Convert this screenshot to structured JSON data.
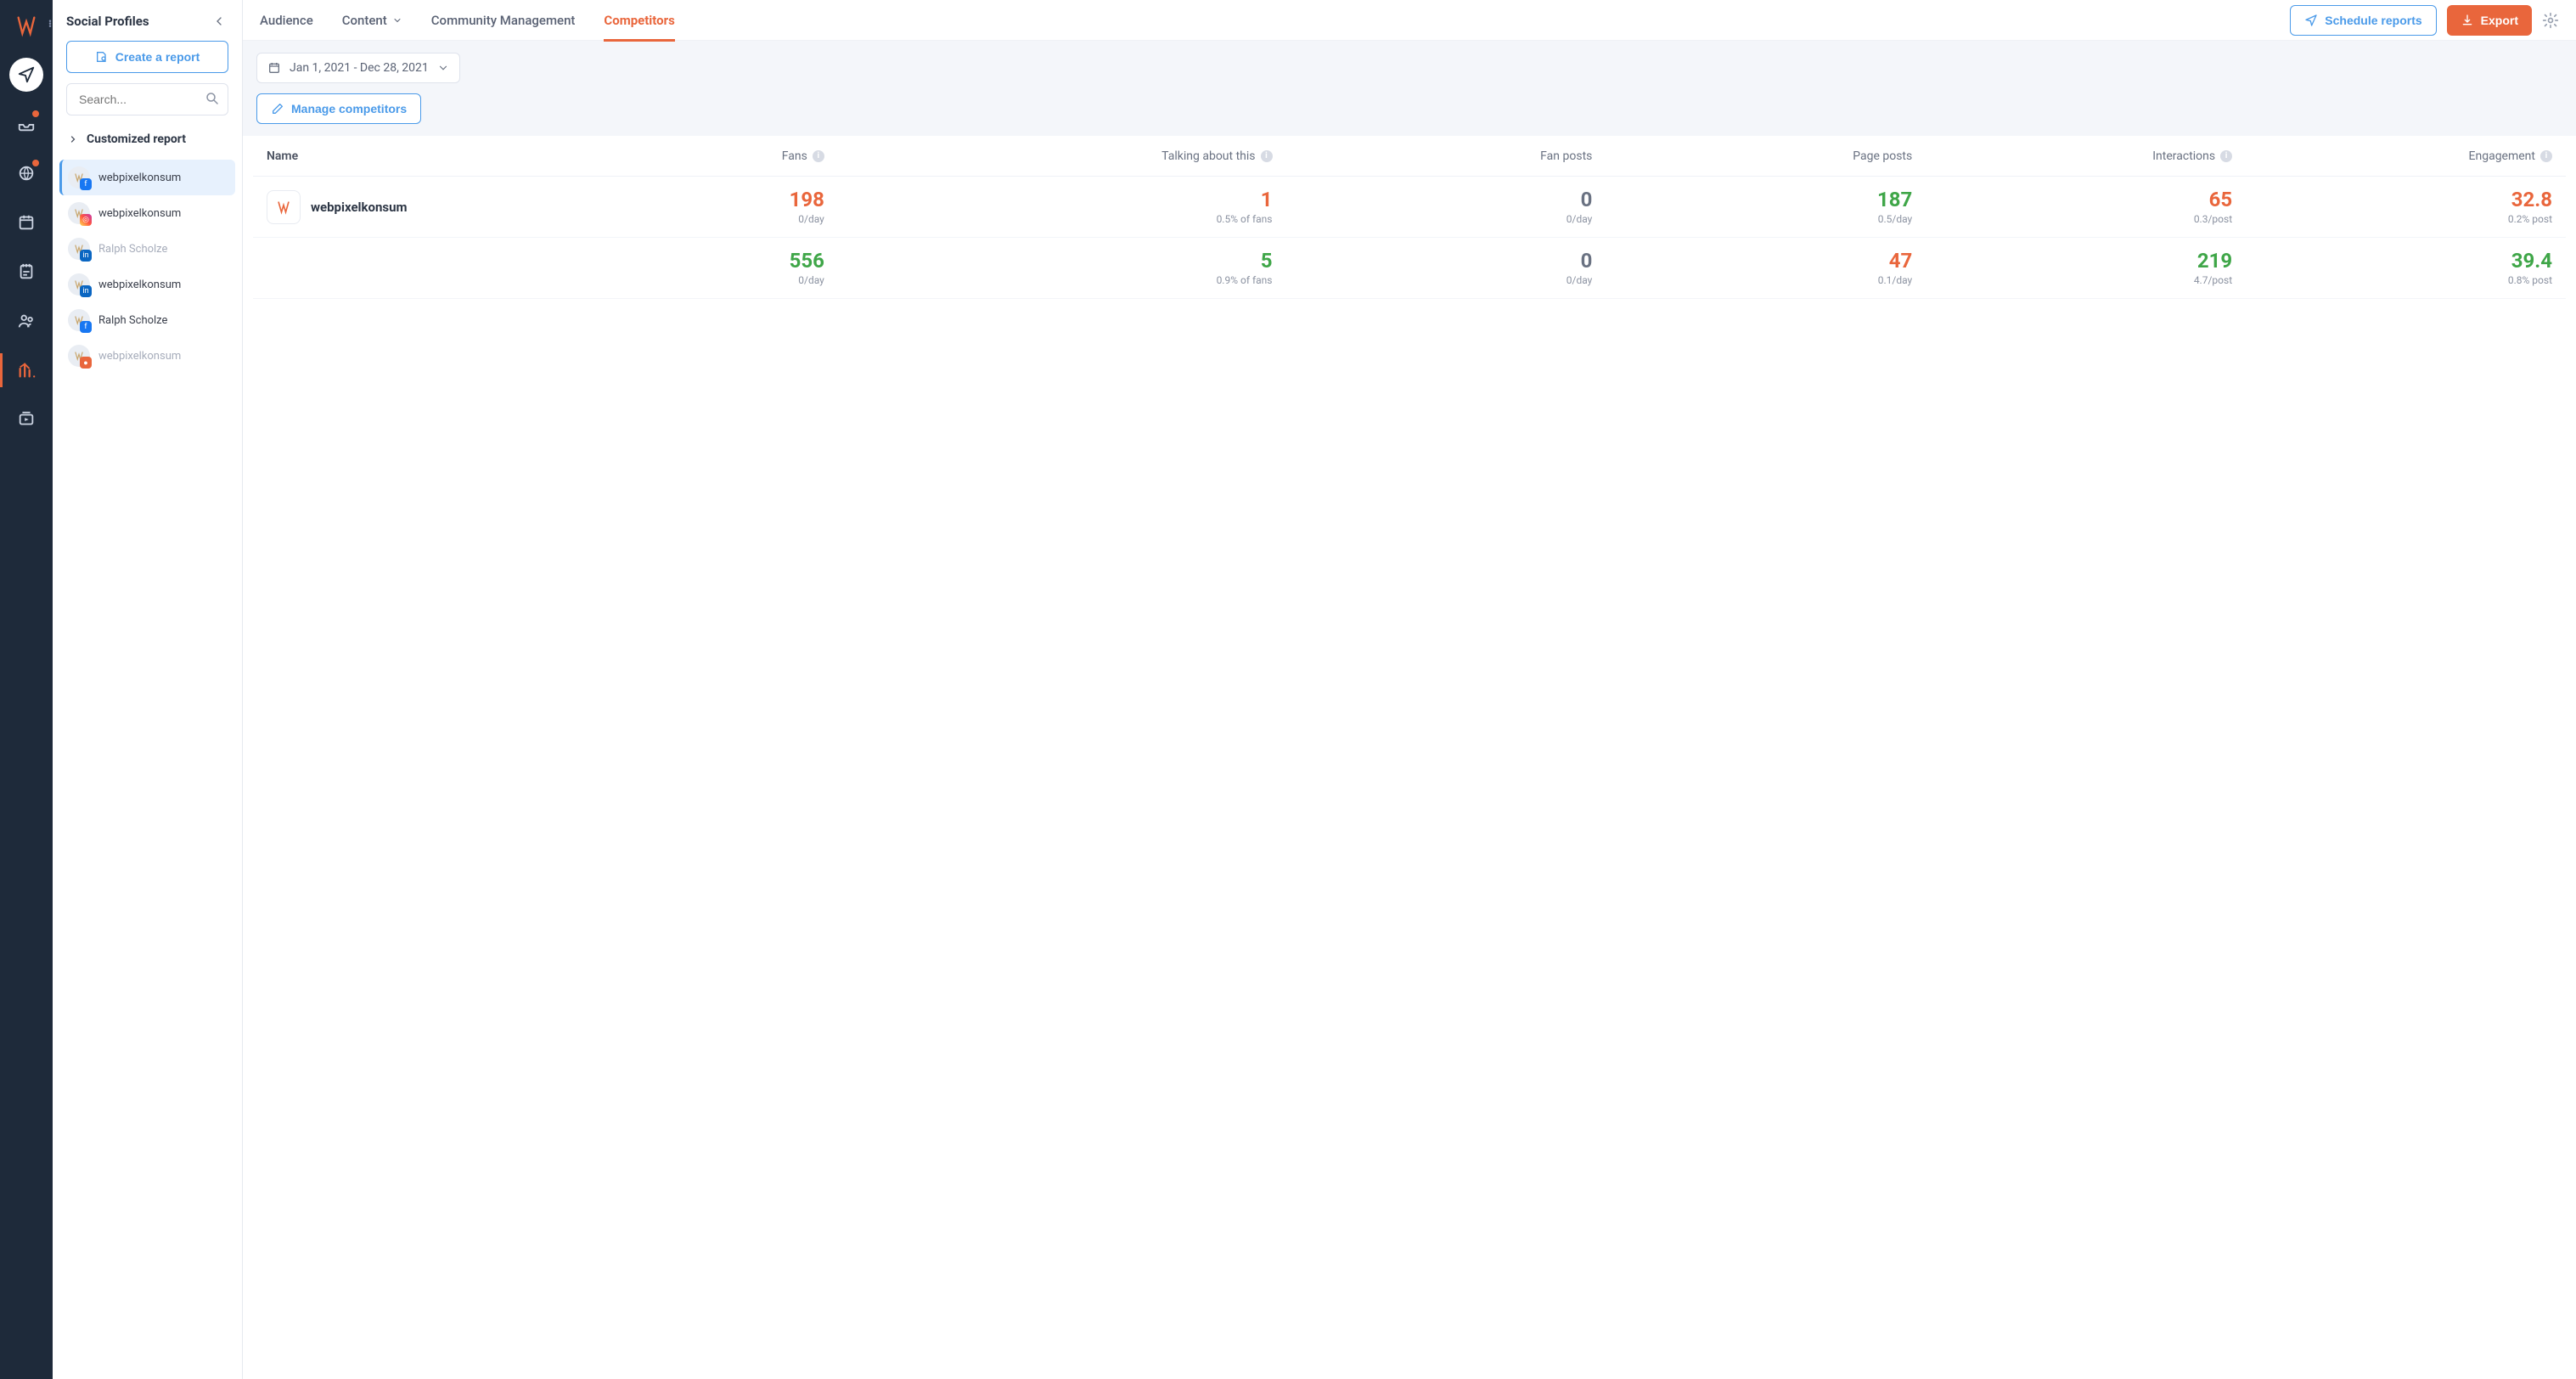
{
  "sidebar": {
    "title": "Social Profiles",
    "create_report_label": "Create a report",
    "search_placeholder": "Search...",
    "customized_label": "Customized report",
    "profiles": [
      {
        "name": "webpixelkonsum",
        "network": "fb",
        "selected": true,
        "muted": false
      },
      {
        "name": "webpixelkonsum",
        "network": "ig",
        "selected": false,
        "muted": false
      },
      {
        "name": "Ralph Scholze",
        "network": "in",
        "selected": false,
        "muted": true
      },
      {
        "name": "webpixelkonsum",
        "network": "in",
        "selected": false,
        "muted": false
      },
      {
        "name": "Ralph Scholze",
        "network": "fb",
        "selected": false,
        "muted": false
      },
      {
        "name": "webpixelkonsum",
        "network": "bl",
        "selected": false,
        "muted": true
      }
    ]
  },
  "tabs": [
    {
      "label": "Audience",
      "active": false,
      "caret": false
    },
    {
      "label": "Content",
      "active": false,
      "caret": true
    },
    {
      "label": "Community Management",
      "active": false,
      "caret": false
    },
    {
      "label": "Competitors",
      "active": true,
      "caret": false
    }
  ],
  "top_actions": {
    "schedule_label": "Schedule reports",
    "export_label": "Export"
  },
  "date_range": "Jan 1, 2021 - Dec 28, 2021",
  "manage_label": "Manage competitors",
  "columns": [
    {
      "label": "Name",
      "info": false
    },
    {
      "label": "Fans",
      "info": true
    },
    {
      "label": "Talking about this",
      "info": true
    },
    {
      "label": "Fan posts",
      "info": false
    },
    {
      "label": "Page posts",
      "info": false
    },
    {
      "label": "Interactions",
      "info": true
    },
    {
      "label": "Engagement",
      "info": true
    }
  ],
  "rows": [
    {
      "name": "webpixelkonsum",
      "show_avatar": true,
      "cells": [
        {
          "value": "198",
          "sub": "0/day",
          "color": "orange"
        },
        {
          "value": "1",
          "sub": "0.5% of fans",
          "color": "orange"
        },
        {
          "value": "0",
          "sub": "0/day",
          "color": "grey"
        },
        {
          "value": "187",
          "sub": "0.5/day",
          "color": "green"
        },
        {
          "value": "65",
          "sub": "0.3/post",
          "color": "orange"
        },
        {
          "value": "32.8",
          "sub": "0.2% post",
          "color": "orange"
        }
      ]
    },
    {
      "name": "",
      "show_avatar": false,
      "cells": [
        {
          "value": "556",
          "sub": "0/day",
          "color": "green"
        },
        {
          "value": "5",
          "sub": "0.9% of fans",
          "color": "green"
        },
        {
          "value": "0",
          "sub": "0/day",
          "color": "grey"
        },
        {
          "value": "47",
          "sub": "0.1/day",
          "color": "orange"
        },
        {
          "value": "219",
          "sub": "4.7/post",
          "color": "green"
        },
        {
          "value": "39.4",
          "sub": "0.8% post",
          "color": "green"
        }
      ]
    }
  ]
}
